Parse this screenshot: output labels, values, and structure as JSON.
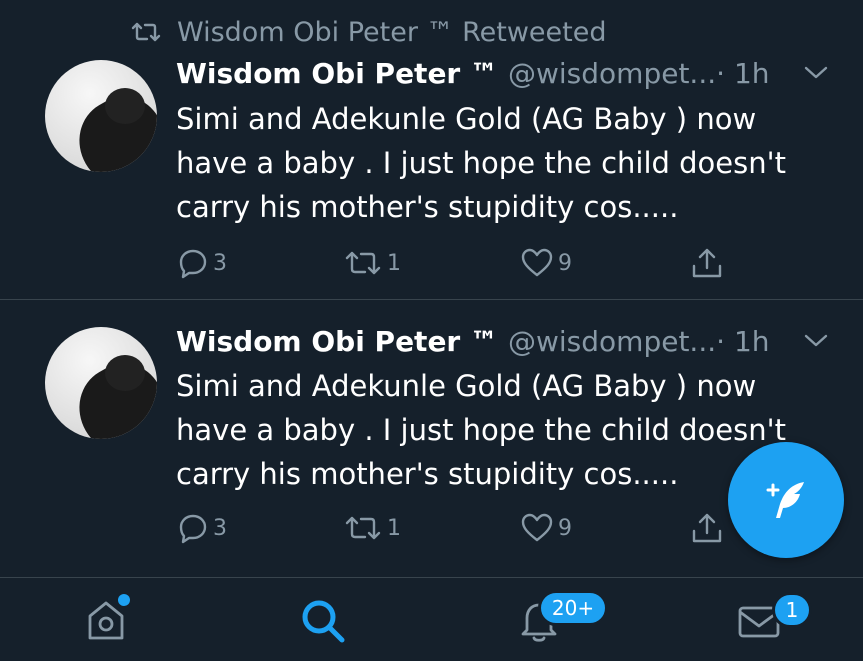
{
  "tweets": [
    {
      "social_context": "Wisdom Obi Peter ™ Retweeted",
      "display_name": "Wisdom Obi Peter ™",
      "handle": "@wisdompet... ",
      "time": "· 1h",
      "text": "Simi and Adekunle Gold (AG Baby ) now have a baby . I just hope the child doesn't carry his mother's stupidity cos.....",
      "reply_count": "3",
      "retweet_count": "1",
      "like_count": "9"
    },
    {
      "display_name": "Wisdom Obi Peter ™",
      "handle": "@wisdompet... ",
      "time": "· 1h",
      "text": "Simi and Adekunle Gold (AG Baby ) now have a baby . I just hope the child doesn't carry his mother's stupidity cos.....",
      "reply_count": "3",
      "retweet_count": "1",
      "like_count": "9"
    }
  ],
  "tabbar": {
    "notifications_badge": "20+",
    "messages_badge": "1"
  },
  "colors": {
    "background": "#15202b",
    "accent": "#1da1f2",
    "secondary_text": "#8899a6",
    "divider": "#38444d"
  },
  "icons": [
    "retweet-icon",
    "chevron-down-icon",
    "reply-icon",
    "like-icon",
    "share-icon",
    "compose-icon",
    "home-icon",
    "search-icon",
    "notifications-icon",
    "messages-icon"
  ]
}
